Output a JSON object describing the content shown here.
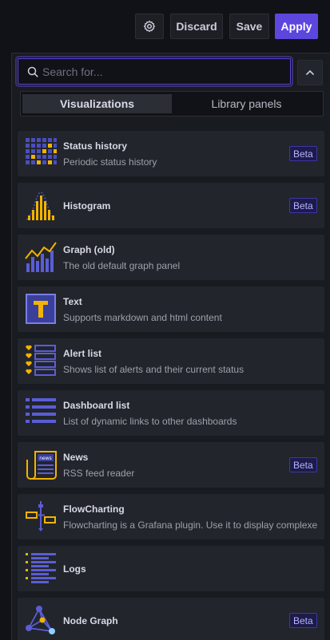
{
  "toolbar": {
    "settings_icon": "gear-icon",
    "discard_label": "Discard",
    "save_label": "Save",
    "apply_label": "Apply",
    "apply_color": "#5b47de"
  },
  "search": {
    "placeholder": "Search for...",
    "value": ""
  },
  "tabs": [
    {
      "label": "Visualizations",
      "active": true
    },
    {
      "label": "Library panels",
      "active": false
    }
  ],
  "visualizations": [
    {
      "title": "Status history",
      "description": "Periodic status history",
      "badge": "Beta",
      "icon": "status-history-icon"
    },
    {
      "title": "Histogram",
      "description": "",
      "badge": "Beta",
      "icon": "histogram-icon"
    },
    {
      "title": "Graph (old)",
      "description": "The old default graph panel",
      "badge": "",
      "icon": "graph-icon"
    },
    {
      "title": "Text",
      "description": "Supports markdown and html content",
      "badge": "",
      "icon": "text-icon"
    },
    {
      "title": "Alert list",
      "description": "Shows list of alerts and their current status",
      "badge": "",
      "icon": "alert-list-icon"
    },
    {
      "title": "Dashboard list",
      "description": "List of dynamic links to other dashboards",
      "badge": "",
      "icon": "dashboard-list-icon"
    },
    {
      "title": "News",
      "description": "RSS feed reader",
      "badge": "Beta",
      "icon": "news-icon"
    },
    {
      "title": "FlowCharting",
      "description": "Flowcharting is a Grafana plugin. Use it to display complexe",
      "badge": "",
      "icon": "flowcharting-icon"
    },
    {
      "title": "Logs",
      "description": "",
      "badge": "",
      "icon": "logs-icon"
    },
    {
      "title": "Node Graph",
      "description": "",
      "badge": "Beta",
      "icon": "node-graph-icon"
    }
  ]
}
